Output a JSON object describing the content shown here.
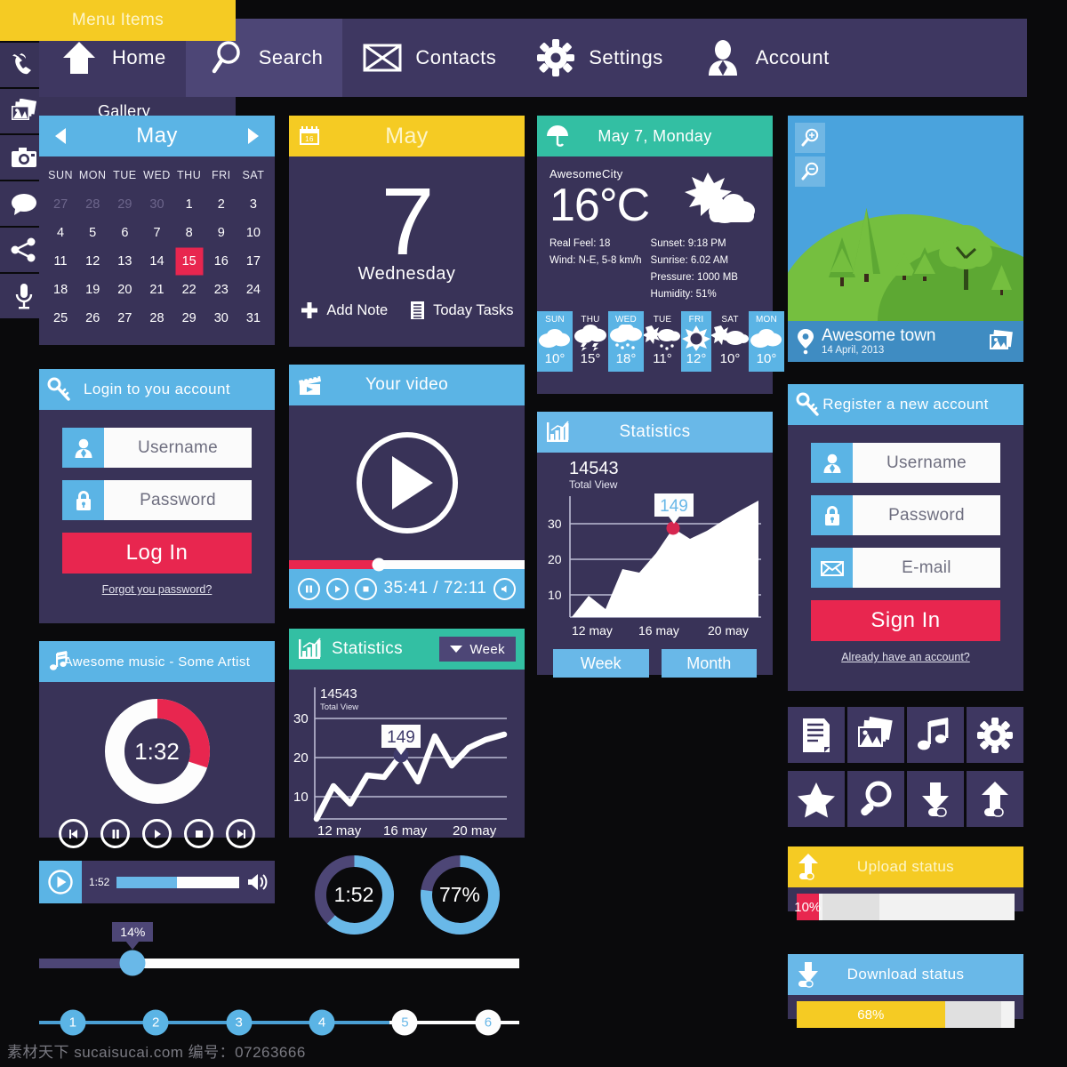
{
  "colors": {
    "bg": "#0a0a0c",
    "navy": "#393358",
    "navy_light": "#3e3761",
    "blue": "#5bb4e5",
    "light_blue": "#69b8e8",
    "teal": "#33bfa3",
    "yellow": "#f5cb23",
    "red": "#e8264f",
    "green": "#75bf3f"
  },
  "topnav": {
    "items": [
      {
        "label": "Home",
        "icon": "home-icon",
        "active": false
      },
      {
        "label": "Search",
        "icon": "search-icon",
        "active": true
      },
      {
        "label": "Contacts",
        "icon": "envelope-icon",
        "active": false
      },
      {
        "label": "Settings",
        "icon": "gear-icon",
        "active": false
      },
      {
        "label": "Account",
        "icon": "user-icon",
        "active": false
      }
    ]
  },
  "calendar": {
    "month": "May",
    "prev_icon": "chevron-left-icon",
    "next_icon": "chevron-right-icon",
    "dow": [
      "SUN",
      "MON",
      "TUE",
      "WED",
      "THU",
      "FRI",
      "SAT"
    ],
    "selected_day": 15,
    "weeks": [
      [
        {
          "n": "27",
          "mute": true
        },
        {
          "n": "28",
          "mute": true
        },
        {
          "n": "29",
          "mute": true
        },
        {
          "n": "30",
          "mute": true
        },
        {
          "n": "1"
        },
        {
          "n": "2"
        },
        {
          "n": "3"
        }
      ],
      [
        {
          "n": "4"
        },
        {
          "n": "5"
        },
        {
          "n": "6"
        },
        {
          "n": "7"
        },
        {
          "n": "8"
        },
        {
          "n": "9"
        },
        {
          "n": "10"
        }
      ],
      [
        {
          "n": "11"
        },
        {
          "n": "12"
        },
        {
          "n": "13"
        },
        {
          "n": "14"
        },
        {
          "n": "15",
          "sel": true
        },
        {
          "n": "16"
        },
        {
          "n": "17"
        }
      ],
      [
        {
          "n": "18"
        },
        {
          "n": "19"
        },
        {
          "n": "20"
        },
        {
          "n": "21"
        },
        {
          "n": "22"
        },
        {
          "n": "23"
        },
        {
          "n": "24"
        }
      ],
      [
        {
          "n": "25"
        },
        {
          "n": "26"
        },
        {
          "n": "27"
        },
        {
          "n": "28"
        },
        {
          "n": "29"
        },
        {
          "n": "30"
        },
        {
          "n": "31"
        }
      ]
    ]
  },
  "day_widget": {
    "header": "May",
    "header_icon": "calendar-icon",
    "day_number": "7",
    "day_name": "Wednesday",
    "add_note_label": "Add Note",
    "add_note_icon": "plus-icon",
    "today_tasks_label": "Today Tasks",
    "today_tasks_icon": "list-icon"
  },
  "weather": {
    "header": "May 7, Monday",
    "header_icon": "umbrella-icon",
    "city": "AwesomeCity",
    "temperature": "16°C",
    "condition_icon": "sun-cloud-icon",
    "left_details": [
      "Real Feel: 18",
      "Wind: N-E, 5-8 km/h"
    ],
    "right_details": [
      "Sunset: 9:18 PM",
      "Sunrise: 6.02 AM",
      "Pressure: 1000 MB",
      "Humidity: 51%"
    ],
    "forecast": [
      {
        "day": "SUN",
        "temp": "10°",
        "icon": "clouds-icon",
        "highlight": true
      },
      {
        "day": "THU",
        "temp": "15°",
        "icon": "thunderstorm-icon",
        "highlight": false
      },
      {
        "day": "WED",
        "temp": "18°",
        "icon": "rain-icon",
        "highlight": true
      },
      {
        "day": "TUE",
        "temp": "11°",
        "icon": "sun-rain-icon",
        "highlight": false
      },
      {
        "day": "FRI",
        "temp": "12°",
        "icon": "sun-icon",
        "highlight": true
      },
      {
        "day": "SAT",
        "temp": "10°",
        "icon": "sun-cloud-icon",
        "highlight": false
      },
      {
        "day": "MON",
        "temp": "10°",
        "icon": "clouds-icon",
        "highlight": true
      }
    ]
  },
  "map": {
    "zoom_in_icon": "magnifier-plus-icon",
    "zoom_out_icon": "magnifier-minus-icon",
    "pin_icon": "location-pin-icon",
    "town": "Awesome town",
    "date": "14 April, 2013",
    "gallery_icon": "photos-icon"
  },
  "login": {
    "header": "Login to you account",
    "header_icon": "key-icon",
    "fields": [
      {
        "label": "Username",
        "icon": "user-icon"
      },
      {
        "label": "Password",
        "icon": "lock-icon"
      }
    ],
    "button": "Log In",
    "link": "Forgot you password?"
  },
  "register": {
    "header": "Register a new account",
    "header_icon": "key-icon",
    "fields": [
      {
        "label": "Username",
        "icon": "user-icon"
      },
      {
        "label": "Password",
        "icon": "lock-icon"
      },
      {
        "label": "E-mail",
        "icon": "envelope-icon"
      }
    ],
    "button": "Sign In",
    "link": "Already have an account?"
  },
  "video": {
    "header": "Your video",
    "header_icon": "film-clapper-icon",
    "play_icon": "play-circle-icon",
    "time": "35:41 / 72:11",
    "progress_percent": 38,
    "controls": [
      "pause-icon",
      "play-icon",
      "stop-icon"
    ],
    "volume_icon": "speaker-icon"
  },
  "stats_area": {
    "header": "Statistics",
    "header_icon": "bar-chart-icon",
    "total": "14543",
    "total_label": "Total View",
    "tooltip": "149",
    "week_button": "Week",
    "month_button": "Month"
  },
  "stats_line": {
    "header": "Statistics",
    "header_icon": "bar-chart-icon",
    "range_button": "Week",
    "range_icon": "chevron-down-icon",
    "total": "14543",
    "total_label": "Total View",
    "tooltip": "149"
  },
  "chart_data": [
    {
      "type": "area",
      "title": "Statistics",
      "total_views": 14543,
      "annotation": "149",
      "xlabel": "",
      "ylabel": "",
      "grid": true,
      "ylim": [
        0,
        34
      ],
      "yticks": [
        10,
        20,
        30
      ],
      "xtick_labels": [
        "12 may",
        "16 may",
        "20 may"
      ],
      "x": [
        11,
        12,
        13,
        14,
        15,
        16,
        17,
        18,
        19,
        20,
        21,
        22
      ],
      "values": [
        0,
        6.5,
        3.5,
        14,
        13,
        18,
        25.5,
        22,
        25,
        27.5,
        30,
        32.5
      ],
      "annotated_point": {
        "x": 17,
        "y": 25.5,
        "label": "149"
      }
    },
    {
      "type": "line",
      "title": "Statistics",
      "total_views": 14543,
      "annotation": "149",
      "range": "Week",
      "xlabel": "",
      "ylabel": "",
      "grid": true,
      "ylim": [
        0,
        32
      ],
      "yticks": [
        10,
        20,
        30
      ],
      "xtick_labels": [
        "12 may",
        "16 may",
        "20 may"
      ],
      "x": [
        11,
        12,
        13,
        14,
        15,
        16,
        17,
        18,
        19,
        20,
        21,
        22
      ],
      "values": [
        0,
        8.5,
        4.5,
        13.5,
        13,
        19.5,
        12,
        25.5,
        18,
        24,
        26.5,
        28
      ],
      "annotated_point": {
        "x": 16,
        "y": 19.5,
        "label": "149"
      }
    }
  ],
  "music": {
    "header": "Awesome music - Some Artist",
    "header_icon": "music-note-icon",
    "time": "1:32",
    "progress_percent": 30,
    "controls": [
      "prev-icon",
      "pause-icon",
      "play-icon",
      "stop-icon",
      "next-icon"
    ]
  },
  "audio_bar": {
    "play_icon": "play-circle-icon",
    "time": "1:52",
    "progress_percent": 49,
    "volume_icon": "speaker-icon"
  },
  "donuts": [
    {
      "label": "1:52",
      "percent": 62,
      "track": "#4d4676",
      "fill": "#69b8e8"
    },
    {
      "label": "77%",
      "percent": 77,
      "track": "#4d4676",
      "fill": "#69b8e8"
    }
  ],
  "big_slider": {
    "tooltip": "14%",
    "percent": 14
  },
  "steps": {
    "items": [
      "1",
      "2",
      "3",
      "4",
      "5",
      "6"
    ],
    "active_count": 4
  },
  "icon_grid": {
    "rows": [
      [
        "document-icon",
        "photos-icon",
        "music-note-icon",
        "gear-icon"
      ],
      [
        "star-icon",
        "magnifier-icon",
        "download-icon",
        "upload-icon"
      ]
    ]
  },
  "menu": {
    "header": "Menu Items",
    "items": [
      {
        "label": "Call",
        "icon": "phone-icon"
      },
      {
        "label": "Gallery",
        "icon": "photos-icon"
      },
      {
        "label": "Camera",
        "icon": "camera-icon"
      },
      {
        "label": "Messages",
        "icon": "chat-bubble-icon"
      },
      {
        "label": "Share",
        "icon": "share-icon"
      },
      {
        "label": "Audio",
        "icon": "microphone-icon"
      }
    ]
  },
  "upload_status": {
    "header": "Upload status",
    "header_icon": "upload-icon",
    "percent": "10%",
    "value": 10,
    "fill_color": "#e8264f"
  },
  "download_status": {
    "header": "Download status",
    "header_icon": "download-icon",
    "percent": "68%",
    "value": 68,
    "fill_color": "#f5cb23"
  },
  "watermark": "素材天下 sucaisucai.com 编号：07263666"
}
